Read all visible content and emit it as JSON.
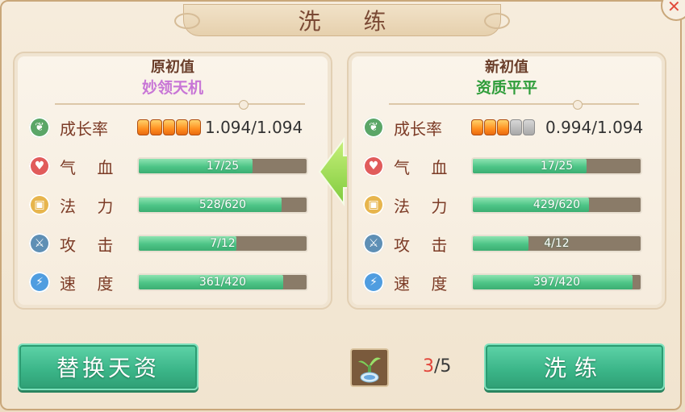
{
  "window": {
    "title": "洗 练",
    "close_icon": "close-icon"
  },
  "left_panel": {
    "title": "原初值",
    "quality": "妙领天机",
    "growth": {
      "label": "成长率",
      "pips_filled": 5,
      "pips_total": 5,
      "value": "1.094/1.094"
    },
    "stats": [
      {
        "icon": "sprout-icon",
        "label": "气 血",
        "value": "17/25",
        "ratio": 0.68
      },
      {
        "icon": "mana-icon",
        "label": "法 力",
        "value": "528/620",
        "ratio": 0.85
      },
      {
        "icon": "sword-icon",
        "label": "攻 击",
        "value": "7/12",
        "ratio": 0.58
      },
      {
        "icon": "lightning-icon",
        "label": "速 度",
        "value": "361/420",
        "ratio": 0.86
      }
    ]
  },
  "right_panel": {
    "title": "新初值",
    "quality": "资质平平",
    "growth": {
      "label": "成长率",
      "pips_filled": 3,
      "pips_total": 5,
      "value": "0.994/1.094"
    },
    "stats": [
      {
        "icon": "heart-icon",
        "label": "气 血",
        "value": "17/25",
        "ratio": 0.68
      },
      {
        "icon": "mana-icon",
        "label": "法 力",
        "value": "429/620",
        "ratio": 0.69
      },
      {
        "icon": "sword-icon",
        "label": "攻 击",
        "value": "4/12",
        "ratio": 0.33
      },
      {
        "icon": "lightning-icon",
        "label": "速 度",
        "value": "397/420",
        "ratio": 0.95
      }
    ]
  },
  "footer": {
    "replace_label": "替换天资",
    "refine_label": "洗练",
    "counter_current": "3",
    "counter_total": "/5"
  },
  "colors": {
    "accent_green": "#3ab487",
    "quality_purple": "#c876d6",
    "quality_green": "#2f9d3a"
  }
}
